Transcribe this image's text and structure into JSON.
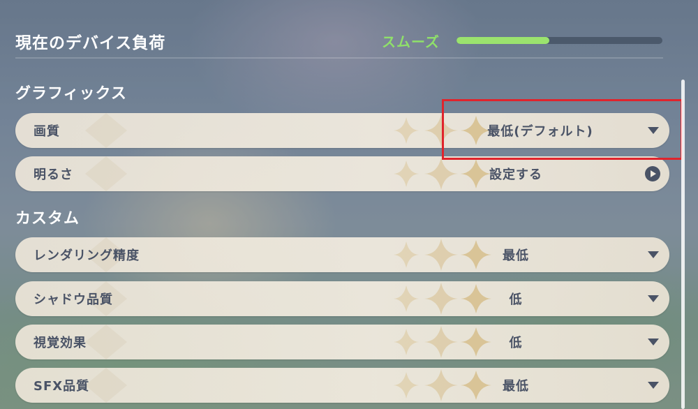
{
  "header": {
    "title": "現在のデバイス負荷",
    "load_status": "スムーズ",
    "load_level": 0.45,
    "load_color": "#9be36e"
  },
  "sections": {
    "graphics": {
      "title": "グラフィックス",
      "quality": {
        "label": "画質",
        "value": "最低(デフォルト)",
        "control": "caret-down-icon"
      },
      "brightness": {
        "label": "明るさ",
        "value": "設定する",
        "control": "arrow-right-circle-icon"
      }
    },
    "custom": {
      "title": "カスタム",
      "render_resolution": {
        "label": "レンダリング精度",
        "value": "最低",
        "control": "caret-down-icon"
      },
      "shadow_quality": {
        "label": "シャドウ品質",
        "value": "低",
        "control": "caret-down-icon"
      },
      "visual_effects": {
        "label": "視覚効果",
        "value": "低",
        "control": "caret-down-icon"
      },
      "sfx_quality": {
        "label": "SFX品質",
        "value": "最低",
        "control": "caret-down-icon"
      }
    }
  },
  "colors": {
    "highlight": "#e0242c",
    "row_text": "#4a5366"
  }
}
